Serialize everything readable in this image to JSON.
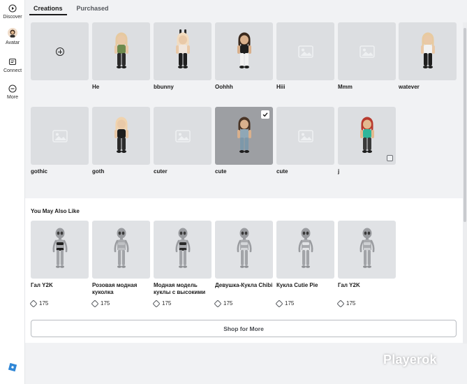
{
  "nav": {
    "items": [
      {
        "label": "Discover",
        "icon": "play-circle-icon"
      },
      {
        "label": "Avatar",
        "icon": "avatar-icon"
      },
      {
        "label": "Connect",
        "icon": "chat-icon"
      },
      {
        "label": "More",
        "icon": "more-circle-icon"
      }
    ],
    "logo_icon": "roblox-logo-icon"
  },
  "tabs": [
    {
      "label": "Creations",
      "active": true
    },
    {
      "label": "Purchased",
      "active": false
    }
  ],
  "creations": [
    {
      "name": "",
      "type": "add"
    },
    {
      "name": "He",
      "type": "avatar",
      "skin": "#e9c9a8",
      "hair": "#e6c9a0",
      "top": "#6e8b4e",
      "bottom": "#2b2b2b"
    },
    {
      "name": "bbunny",
      "type": "avatar",
      "skin": "#e9c9a8",
      "hair": "#f2dcc0",
      "top": "#f0e6dd",
      "bottom": "#1e1e1e",
      "ears": true
    },
    {
      "name": "Oohhh",
      "type": "avatar",
      "skin": "#d9b08c",
      "hair": "#3b2a1e",
      "top": "#1e1e1e",
      "bottom": "#f2f2f2"
    },
    {
      "name": "Hiii",
      "type": "empty"
    },
    {
      "name": "Mmm",
      "type": "empty"
    },
    {
      "name": "watever",
      "type": "avatar",
      "skin": "#e9c9a8",
      "hair": "#e8caa0",
      "top": "#f2f2f2",
      "bottom": "#1e1e1e"
    },
    {
      "name": "gothic",
      "type": "empty"
    },
    {
      "name": "goth",
      "type": "avatar",
      "skin": "#e9c9a8",
      "hair": "#f0d3ae",
      "top": "#1e1e1e",
      "bottom": "#2b2b2b"
    },
    {
      "name": "cuter",
      "type": "empty"
    },
    {
      "name": "cute",
      "type": "avatar",
      "skin": "#d9b08c",
      "hair": "#4a3526",
      "top": "#8fa7b6",
      "bottom": "#7d98aa",
      "selected": true
    },
    {
      "name": "cute",
      "type": "empty"
    },
    {
      "name": "j",
      "type": "avatar",
      "skin": "#e3b98f",
      "hair": "#b83a2e",
      "top": "#2fb59a",
      "bottom": "#3a3a3a",
      "badge": true
    }
  ],
  "recommendations": {
    "title": "You May Also Like",
    "items": [
      {
        "name": "Гал Y2K",
        "price": "175",
        "outfit": "#1e1e1e"
      },
      {
        "name": "Розовая модная куколка",
        "price": "175",
        "outfit": "#bfc1c4"
      },
      {
        "name": "Модная модель куклы с высокими",
        "price": "175",
        "outfit": "#2b2b2b"
      },
      {
        "name": "Девушка-Кукла Chibi",
        "price": "175",
        "outfit": "#d4d6d9"
      },
      {
        "name": "Кукла Cutie Pie",
        "price": "175",
        "outfit": "#e2e4e6"
      },
      {
        "name": "Гал Y2K",
        "price": "175",
        "outfit": "#cfd1d4"
      }
    ],
    "shop_label": "Shop for More"
  },
  "watermark": "Playerok",
  "colors": {
    "accent": "#1b1b1b",
    "card_bg": "#dcdee1",
    "selected_bg": "#9d9fa3",
    "page_bg": "#f1f2f4"
  }
}
